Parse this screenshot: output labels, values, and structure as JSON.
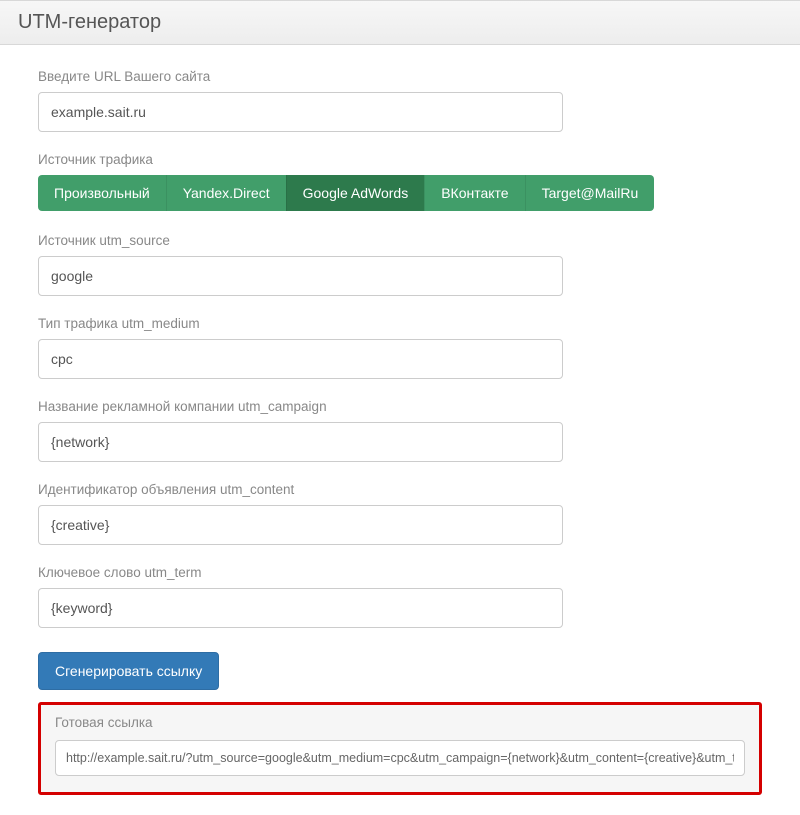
{
  "header": {
    "title": "UTM-генератор"
  },
  "form": {
    "url": {
      "label": "Введите URL Вашего сайта",
      "value": "example.sait.ru"
    },
    "traffic_source": {
      "label": "Источник трафика",
      "options": [
        {
          "label": "Произвольный",
          "active": false
        },
        {
          "label": "Yandex.Direct",
          "active": false
        },
        {
          "label": "Google AdWords",
          "active": true
        },
        {
          "label": "ВКонтакте",
          "active": false
        },
        {
          "label": "Target@MailRu",
          "active": false
        }
      ]
    },
    "utm_source": {
      "label": "Источник utm_source",
      "value": "google"
    },
    "utm_medium": {
      "label": "Тип трафика utm_medium",
      "value": "cpc"
    },
    "utm_campaign": {
      "label": "Название рекламной компании utm_campaign",
      "value": "{network}"
    },
    "utm_content": {
      "label": "Идентификатор объявления utm_content",
      "value": "{creative}"
    },
    "utm_term": {
      "label": "Ключевое слово utm_term",
      "value": "{keyword}"
    },
    "generate_button": "Сгенерировать ссылку"
  },
  "result": {
    "label": "Готовая ссылка",
    "value": "http://example.sait.ru/?utm_source=google&utm_medium=cpc&utm_campaign={network}&utm_content={creative}&utm_term={keyword}"
  }
}
